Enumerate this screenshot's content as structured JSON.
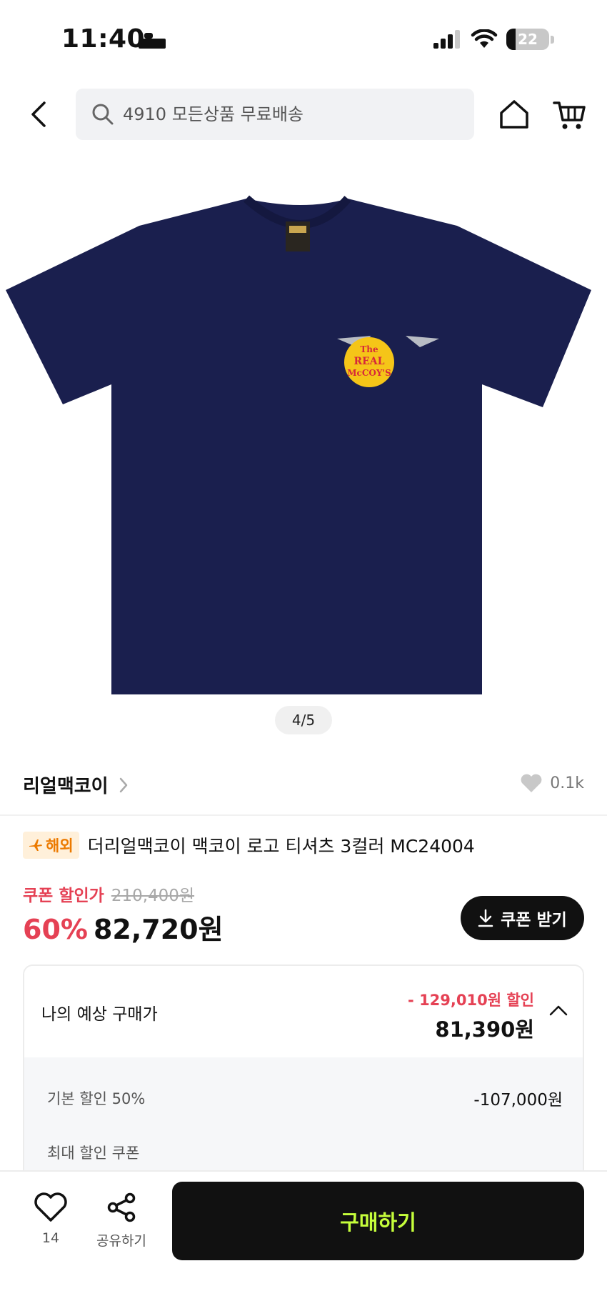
{
  "status_bar": {
    "time": "11:40",
    "battery": "22",
    "battery_level": 0.22
  },
  "header": {
    "search_placeholder": "4910 모든상품 무료배송"
  },
  "product": {
    "image_pager": "4/5",
    "brand": "리얼맥코이",
    "likes": "0.1k",
    "overseas_badge": "해외",
    "title": "더리얼맥코이 맥코이 로고 티셔츠 3컬러 MC24004",
    "tshirt_logo": [
      "The",
      "REAL",
      "McCOY'S"
    ]
  },
  "price": {
    "coupon_label": "쿠폰 할인가",
    "original_price": "210,400원",
    "discount_rate": "60%",
    "sale_price": "82,720원",
    "coupon_button": "쿠폰 받기"
  },
  "expected_price": {
    "label": "나의 예상 구매가",
    "discount": "- 129,010원 할인",
    "price": "81,390원",
    "basic_discount_label": "기본 할인 50%",
    "basic_discount_value": "-107,000원",
    "max_coupon_label": "최대 할인 쿠폰"
  },
  "bottom_bar": {
    "wish_count": "14",
    "share_label": "공유하기",
    "buy_label": "구매하기"
  },
  "colors": {
    "accent_red": "#e54154",
    "buy_text": "#c6ff3b",
    "dark": "#111111",
    "tshirt_navy": "#1a1f4e"
  }
}
